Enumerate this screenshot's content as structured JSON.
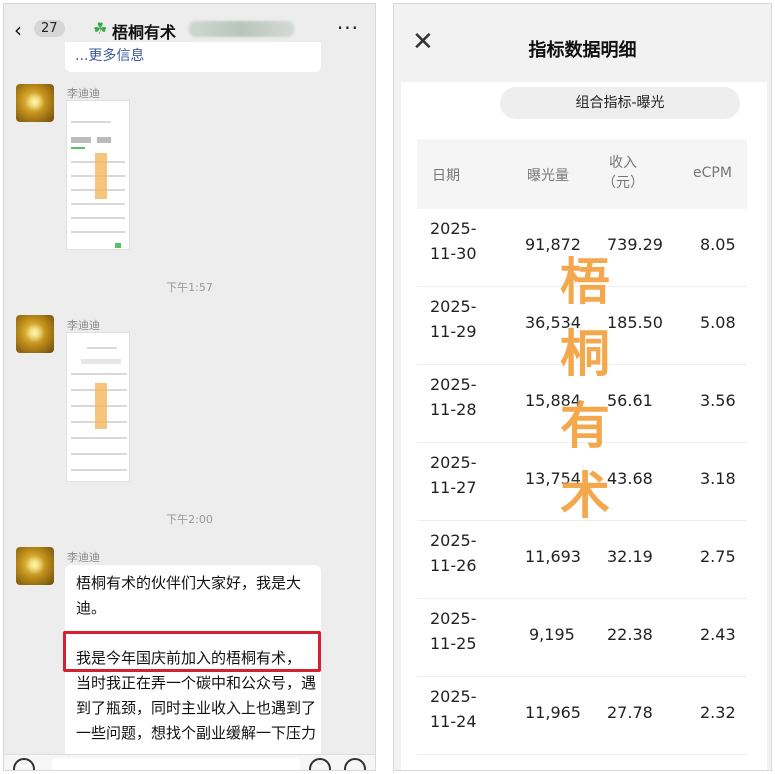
{
  "chat": {
    "back_count": "27",
    "title": "梧桐有术",
    "more": "···",
    "prev_text": "...更多信息",
    "messages": [
      {
        "sender": "李迪迪"
      },
      {
        "sender": "李迪迪"
      },
      {
        "sender": "李迪迪"
      }
    ],
    "times": [
      "下午1:57",
      "下午2:00"
    ],
    "text_para1": "梧桐有术的伙伴们大家好，我是大迪。",
    "text_highlight": "我是今年国庆前加入的梧桐有术，",
    "text_rest": "当时我正在弄一个碳中和公众号，遇到了瓶颈，同时主业收入上也遇到了一些问题，想找个副业缓解一下压力",
    "colors": {
      "highlight_border": "#d42031",
      "watermark": "#f39a2f"
    }
  },
  "detail": {
    "title": "指标数据明细",
    "close_icon": "close-icon",
    "filter_pill": "组合指标-曝光",
    "headers": {
      "date": "日期",
      "exposure": "曝光量",
      "revenue": "收入\n（元）",
      "ecpm": "eCPM"
    },
    "rows": [
      {
        "date": "2025-\n11-30",
        "exposure": "91,872",
        "revenue": "739.29",
        "ecpm": "8.05"
      },
      {
        "date": "2025-\n11-29",
        "exposure": "36,534",
        "revenue": "185.50",
        "ecpm": "5.08"
      },
      {
        "date": "2025-\n11-28",
        "exposure": "15,884",
        "revenue": "56.61",
        "ecpm": "3.56"
      },
      {
        "date": "2025-\n11-27",
        "exposure": "13,754",
        "revenue": "43.68",
        "ecpm": "3.18"
      },
      {
        "date": "2025-\n11-26",
        "exposure": "11,693",
        "revenue": "32.19",
        "ecpm": "2.75"
      },
      {
        "date": "2025-\n11-25",
        "exposure": "9,195",
        "revenue": "22.38",
        "ecpm": "2.43"
      },
      {
        "date": "2025-\n11-24",
        "exposure": "11,965",
        "revenue": "27.78",
        "ecpm": "2.32"
      }
    ],
    "watermark_chars": [
      "梧",
      "桐",
      "有",
      "术"
    ]
  }
}
